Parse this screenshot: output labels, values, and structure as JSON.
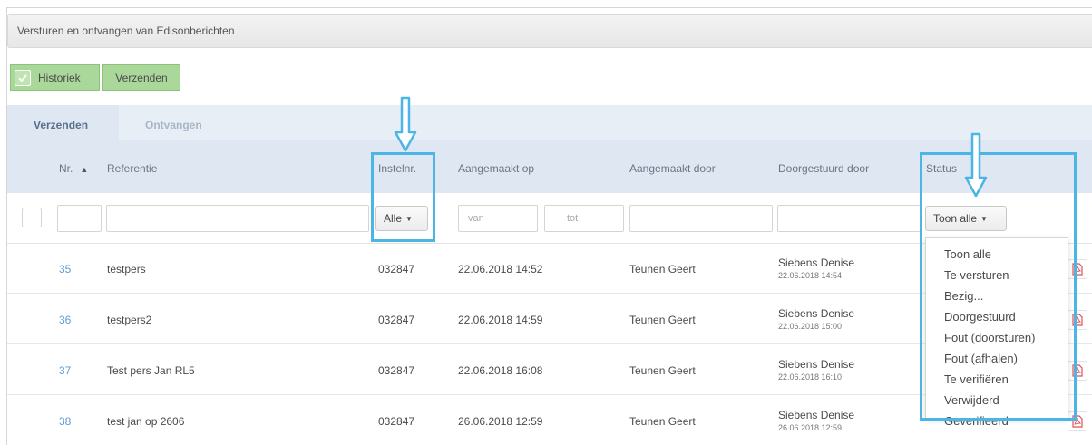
{
  "window": {
    "title": "Versturen en ontvangen van Edisonberichten"
  },
  "toolbar": {
    "history_label": "Historiek",
    "send_label": "Verzenden"
  },
  "tabs": [
    {
      "label": "Verzenden",
      "active": true
    },
    {
      "label": "Ontvangen",
      "active": false
    }
  ],
  "columns": {
    "nr": "Nr.",
    "referentie": "Referentie",
    "instelnr": "Instelnr.",
    "aangemaakt_op": "Aangemaakt op",
    "aangemaakt_door": "Aangemaakt door",
    "doorgestuurd_door": "Doorgestuurd door",
    "status": "Status"
  },
  "filters": {
    "instelnr_select": "Alle",
    "date_from_placeholder": "van",
    "date_to_placeholder": "tot",
    "status_select": "Toon alle"
  },
  "rows": [
    {
      "nr": "35",
      "referentie": "testpers",
      "instelnr": "032847",
      "aangemaakt_op": "22.06.2018 14:52",
      "aangemaakt_door": "Teunen Geert",
      "doorgestuurd_naam": "Siebens Denise",
      "doorgestuurd_datum": "22.06.2018 14:54"
    },
    {
      "nr": "36",
      "referentie": "testpers2",
      "instelnr": "032847",
      "aangemaakt_op": "22.06.2018 14:59",
      "aangemaakt_door": "Teunen Geert",
      "doorgestuurd_naam": "Siebens Denise",
      "doorgestuurd_datum": "22.06.2018 15:00"
    },
    {
      "nr": "37",
      "referentie": "Test pers Jan RL5",
      "instelnr": "032847",
      "aangemaakt_op": "22.06.2018 16:08",
      "aangemaakt_door": "Teunen Geert",
      "doorgestuurd_naam": "Siebens Denise",
      "doorgestuurd_datum": "22.06.2018 16:10"
    },
    {
      "nr": "38",
      "referentie": "test jan op 2606",
      "instelnr": "032847",
      "aangemaakt_op": "26.06.2018 12:59",
      "aangemaakt_door": "Teunen Geert",
      "doorgestuurd_naam": "Siebens Denise",
      "doorgestuurd_datum": "26.06.2018 12:59"
    }
  ],
  "status_menu": [
    "Toon alle",
    "Te versturen",
    "Bezig...",
    "Doorgestuurd",
    "Fout (doorsturen)",
    "Fout (afhalen)",
    "Te verifiëren",
    "Verwijderd",
    "Geverifieerd"
  ],
  "colors": {
    "accent_green": "#aad79a",
    "header_bg": "#dfe7f3",
    "link_blue": "#5c9bd6",
    "highlight": "#4db4e6",
    "pdf_red": "#e05252"
  }
}
